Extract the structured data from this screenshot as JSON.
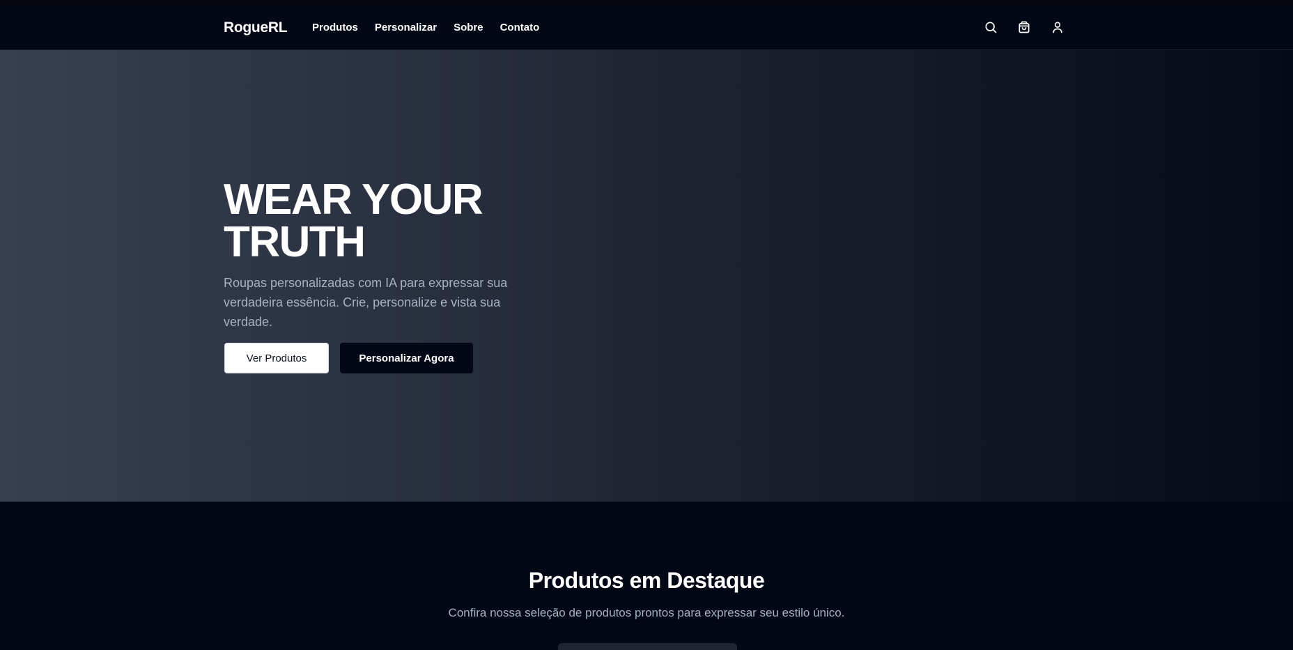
{
  "navbar": {
    "brand": "RogueRL",
    "links": [
      {
        "label": "Produtos"
      },
      {
        "label": "Personalizar"
      },
      {
        "label": "Sobre"
      },
      {
        "label": "Contato"
      }
    ],
    "icons": [
      "search-icon",
      "shopping-bag-icon",
      "user-icon"
    ]
  },
  "hero": {
    "title_line1": "WEAR YOUR",
    "title_line2": "TRUTH",
    "subtitle": "Roupas personalizadas com IA para expressar sua verdadeira essência. Crie, personalize e vista sua verdade.",
    "primary_button": "Ver Produtos",
    "secondary_button": "Personalizar Agora"
  },
  "featured": {
    "title": "Produtos em Destaque",
    "subtitle": "Confira nossa seleção de produtos prontos para expressar seu estilo único."
  },
  "colors": {
    "background": "#030816",
    "hero_gradient_start": "#374050",
    "hero_gradient_end": "#050a18",
    "text_muted": "#a6b1c4",
    "button_light": "#ffffff",
    "button_dark": "#030816"
  }
}
